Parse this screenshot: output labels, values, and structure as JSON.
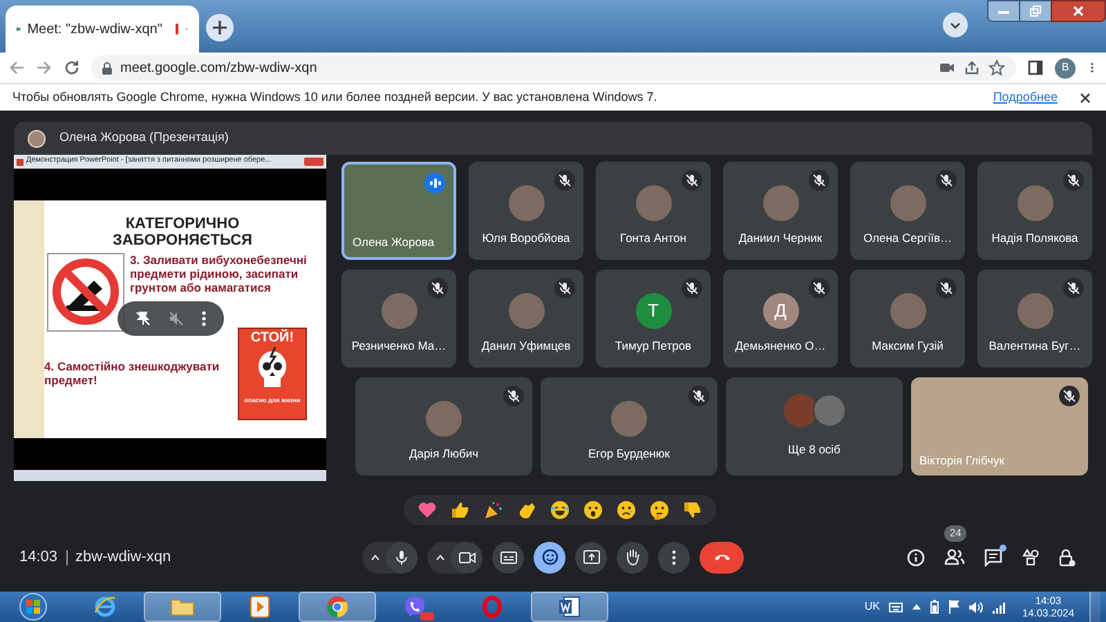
{
  "browser": {
    "tab_title": "Meet: \"zbw-wdiw-xqn\"",
    "recording": true,
    "url": "meet.google.com/zbw-wdiw-xqn",
    "profile_letter": "В",
    "infobar_text": "Чтобы обновлять Google Chrome, нужна Windows 10 или более поздней версии. У вас установлена Windows 7.",
    "infobar_link": "Подробнее"
  },
  "presenter_bar": {
    "label": "Олена Жорова (Презентація)"
  },
  "slide": {
    "window_title": "Демонстрация PowerPoint - [заняття з питаннями розширене обере...",
    "heading": "КАТЕГОРИЧНО ЗАБОРОНЯЄТЬСЯ",
    "item_3": "3. Заливати вибухонебезпечні предмети рідиною, засипати грунтом або намагатися",
    "item_4": "4. Самостійно знешкоджувати предмет!",
    "sign_title": "СТОЙ!",
    "sign_caption": "опасно для жизни"
  },
  "participants": [
    {
      "name": "Олена Жорова",
      "kind": "video",
      "muted": false,
      "speaking": true
    },
    {
      "name": "Юля Воробйова",
      "kind": "photo",
      "muted": true,
      "speaking": false
    },
    {
      "name": "Гонта Антон",
      "kind": "photo",
      "muted": true,
      "speaking": false
    },
    {
      "name": "Даниил Черник",
      "kind": "photo",
      "muted": true,
      "speaking": false
    },
    {
      "name": "Олена Сергіїв…",
      "kind": "photo",
      "muted": true,
      "speaking": false
    },
    {
      "name": "Надія Полякова",
      "kind": "photo",
      "muted": true,
      "speaking": false
    },
    {
      "name": "Резниченко Ма…",
      "kind": "photo",
      "muted": true,
      "speaking": false
    },
    {
      "name": "Данил Уфимцев",
      "kind": "photo",
      "muted": true,
      "speaking": false
    },
    {
      "name": "Тимур Петров",
      "kind": "letter",
      "letter": "Т",
      "color": "#1e8e3e",
      "muted": true,
      "speaking": false
    },
    {
      "name": "Демьяненко О…",
      "kind": "letter",
      "letter": "Д",
      "color": "#a1887f",
      "muted": true,
      "speaking": false
    },
    {
      "name": "Максим Гузій",
      "kind": "photo",
      "muted": true,
      "speaking": false
    },
    {
      "name": "Валентина Буг…",
      "kind": "photo",
      "muted": true,
      "speaking": false
    },
    {
      "name": "Дарія Любич",
      "kind": "photo",
      "muted": true,
      "speaking": false
    },
    {
      "name": "Егор Бурденюк",
      "kind": "photo",
      "muted": true,
      "speaking": false
    },
    {
      "name": "Ще 8 осіб",
      "kind": "more",
      "muted": false,
      "speaking": false
    },
    {
      "name": "Вікторія Глібчук",
      "kind": "video",
      "muted": true,
      "speaking": false
    }
  ],
  "controls": {
    "time": "14:03",
    "meeting_code": "zbw-wdiw-xqn",
    "participant_count": "24",
    "chat_unread": true
  },
  "taskbar": {
    "language": "UK",
    "time": "14:03",
    "date": "14.03.2024"
  }
}
